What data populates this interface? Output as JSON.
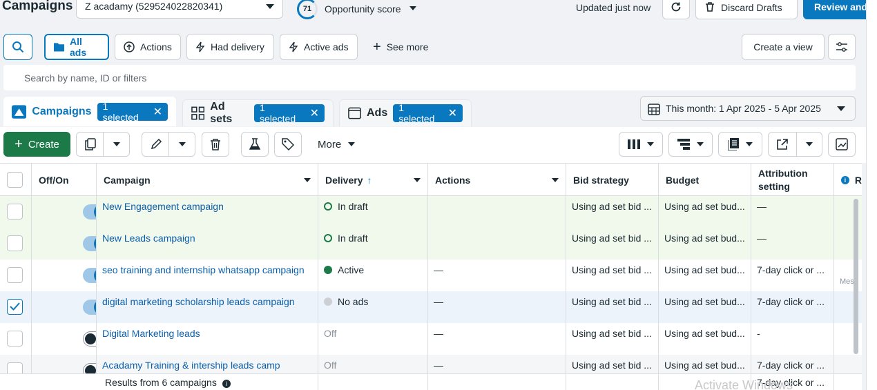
{
  "header": {
    "title": "Campaigns",
    "account": "Z acadamy (529524022820341)",
    "score_value": "71",
    "score_label": "Opportunity score",
    "updated": "Updated just now",
    "discard_label": "Discard Drafts",
    "review_label": "Review and"
  },
  "filters": {
    "all_ads": "All ads",
    "actions": "Actions",
    "had_delivery": "Had delivery",
    "active_ads": "Active ads",
    "see_more": "See more",
    "create_view": "Create a view"
  },
  "search": {
    "placeholder": "Search by name, ID or filters"
  },
  "tabs": {
    "campaigns": {
      "label": "Campaigns",
      "badge": "1 selected"
    },
    "adsets": {
      "label": "Ad sets",
      "badge": "1 selected"
    },
    "ads": {
      "label": "Ads",
      "badge": "1 selected"
    }
  },
  "date_range": "This month: 1 Apr 2025 - 5 Apr 2025",
  "toolbar": {
    "create_label": "Create",
    "more_label": "More"
  },
  "table": {
    "columns": {
      "offon": "Off/On",
      "campaign": "Campaign",
      "delivery": "Delivery",
      "delivery_sort": "↑",
      "actions": "Actions",
      "bid": "Bid strategy",
      "budget": "Budget",
      "attribution_line1": "Attribution",
      "attribution_line2": "setting",
      "results": "R"
    },
    "rows": [
      {
        "name": "New Engagement campaign",
        "delivery": "In draft",
        "actions": "",
        "bid": "Using ad set bid ...",
        "budget": "Using ad set bud...",
        "attribution": "—"
      },
      {
        "name": "New Leads campaign",
        "delivery": "In draft",
        "actions": "",
        "bid": "Using ad set bid ...",
        "budget": "Using ad set bud...",
        "attribution": "—"
      },
      {
        "name": "seo training and internship whatsapp campaign",
        "delivery": "Active",
        "actions": "—",
        "bid": "Using ad set bid ...",
        "budget": "Using ad set bud...",
        "attribution": "7-day click or ...",
        "extra": "Mes"
      },
      {
        "name": "digital marketing scholarship leads campaign",
        "delivery": "No ads",
        "actions": "—",
        "bid": "Using ad set bid ...",
        "budget": "Using ad set bud...",
        "attribution": "7-day click or ..."
      },
      {
        "name": "Digital Marketing leads",
        "delivery": "Off",
        "actions": "—",
        "bid": "Using ad set bid ...",
        "budget": "Using ad set bud...",
        "attribution": "-"
      },
      {
        "name": "Acadamy Training & intership leads camp",
        "delivery": "Off",
        "actions": "—",
        "bid": "Using ad set bid ...",
        "budget": "Using ad set bud...",
        "attribution": "7-day click or ..."
      }
    ],
    "footer_results": "Results from 6 campaigns",
    "footer_attribution": "7-day click or ..."
  },
  "watermark": "Activate Windows"
}
